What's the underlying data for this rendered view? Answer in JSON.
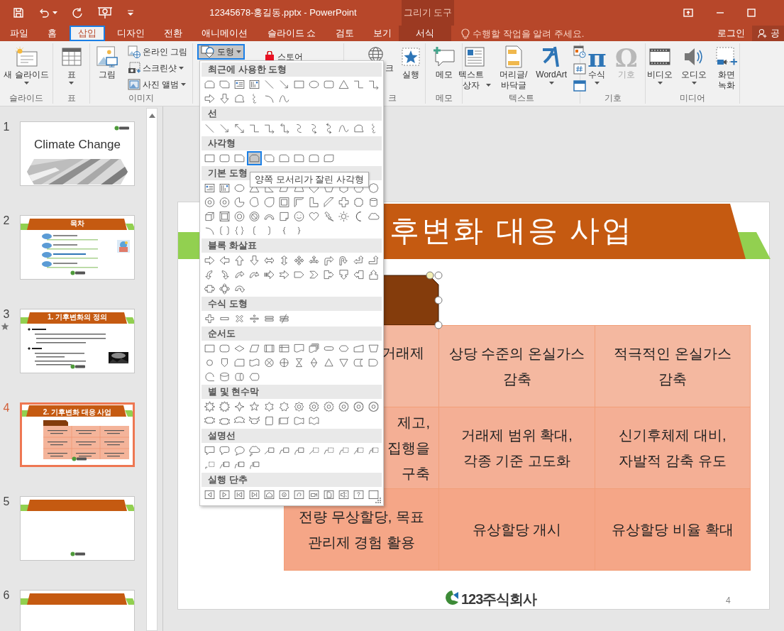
{
  "window": {
    "title": "12345678-홍길동.pptx - PowerPoint",
    "context_group": "그리기 도구"
  },
  "tabs": [
    {
      "label": "파일",
      "kind": "normal",
      "selected": false
    },
    {
      "label": "홈",
      "kind": "normal",
      "selected": false
    },
    {
      "label": "삽입",
      "kind": "normal",
      "selected": true
    },
    {
      "label": "디자인",
      "kind": "normal",
      "selected": false
    },
    {
      "label": "전환",
      "kind": "normal",
      "selected": false
    },
    {
      "label": "애니메이션",
      "kind": "normal",
      "selected": false
    },
    {
      "label": "슬라이드 쇼",
      "kind": "normal",
      "selected": false
    },
    {
      "label": "검토",
      "kind": "normal",
      "selected": false
    },
    {
      "label": "보기",
      "kind": "normal",
      "selected": false
    },
    {
      "label": "서식",
      "kind": "contextual",
      "selected": false
    }
  ],
  "tell_me": {
    "placeholder": "수행할 작업을 알려 주세요."
  },
  "account": {
    "sign_in": "로그인",
    "share": "공"
  },
  "ribbon": {
    "groups": [
      {
        "label": "슬라이드",
        "buttons": [
          {
            "label": "새 슬라이드",
            "kind": "large",
            "dropdown": true,
            "pressed": false,
            "disabled": false
          }
        ]
      },
      {
        "label": "표",
        "buttons": [
          {
            "label": "표",
            "kind": "large",
            "dropdown": true,
            "pressed": false,
            "disabled": false
          }
        ]
      },
      {
        "label": "이미지",
        "buttons": [
          {
            "label": "그림",
            "kind": "large",
            "dropdown": false,
            "pressed": false,
            "disabled": false
          },
          {
            "label": "온라인 그림",
            "kind": "small",
            "dropdown": false,
            "pressed": false,
            "disabled": false
          },
          {
            "label": "스크린샷",
            "kind": "small",
            "dropdown": true,
            "pressed": false,
            "disabled": false
          },
          {
            "label": "사진 앨범",
            "kind": "small",
            "dropdown": true,
            "pressed": false,
            "disabled": false
          }
        ]
      },
      {
        "buttons": [
          {
            "label": "도형",
            "kind": "small",
            "dropdown": true,
            "pressed": true,
            "disabled": false
          }
        ]
      },
      {
        "buttons": [
          {
            "label": "스토어",
            "kind": "small",
            "dropdown": false,
            "pressed": false,
            "disabled": false
          }
        ]
      },
      {
        "label": "크",
        "buttons": [
          {
            "label": "크",
            "kind": "large",
            "dropdown": false,
            "pressed": false,
            "disabled": false
          },
          {
            "label": "실행",
            "kind": "large",
            "dropdown": false,
            "pressed": false,
            "disabled": false
          }
        ]
      },
      {
        "label": "메모",
        "buttons": [
          {
            "label": "메모",
            "kind": "large",
            "dropdown": false,
            "pressed": false,
            "disabled": false
          }
        ]
      },
      {
        "label": "텍스트",
        "buttons": [
          {
            "label": "텍스트\n상자",
            "kind": "large",
            "dropdown": true,
            "pressed": false,
            "disabled": false
          },
          {
            "label": "머리글/\n바닥글",
            "kind": "large",
            "dropdown": false,
            "pressed": false,
            "disabled": false
          },
          {
            "label": "WordArt",
            "kind": "large",
            "dropdown": true,
            "pressed": false,
            "disabled": false
          },
          {
            "kind": "mini",
            "pressed": false,
            "disabled": false
          },
          {
            "kind": "mini",
            "pressed": false,
            "disabled": false
          },
          {
            "kind": "mini",
            "pressed": false,
            "disabled": false
          }
        ]
      },
      {
        "label": "기호",
        "buttons": [
          {
            "label": "수식",
            "symbol": "π",
            "kind": "large",
            "dropdown": true,
            "pressed": false,
            "disabled": false
          },
          {
            "label": "기호",
            "symbol": "Ω",
            "kind": "large",
            "dropdown": false,
            "pressed": false,
            "disabled": true
          }
        ]
      },
      {
        "label": "미디어",
        "buttons": [
          {
            "label": "비디오",
            "kind": "large",
            "dropdown": true,
            "pressed": false,
            "disabled": false
          },
          {
            "label": "오디오",
            "kind": "large",
            "dropdown": true,
            "pressed": false,
            "disabled": false
          },
          {
            "label": "화면\n녹화",
            "kind": "large",
            "dropdown": false,
            "pressed": false,
            "disabled": false
          }
        ]
      }
    ]
  },
  "thumbnails": [
    {
      "number": "1",
      "kind": "title",
      "title": "Climate Change",
      "selected": false,
      "animated": false
    },
    {
      "number": "2",
      "kind": "toc",
      "title": "목차",
      "selected": false,
      "animated": false
    },
    {
      "number": "3",
      "kind": "bullets",
      "title": "1. 기후변화의 정의",
      "selected": false,
      "animated": true
    },
    {
      "number": "4",
      "kind": "table",
      "title": "2. 기후변화 대응 사업",
      "selected": true,
      "animated": false
    },
    {
      "number": "5",
      "kind": "blank",
      "selected": false,
      "animated": false
    },
    {
      "number": "6",
      "kind": "banner",
      "selected": false,
      "animated": false
    }
  ],
  "slide": {
    "title": "후변화 대응 사업",
    "table": {
      "rows": [
        [
          "거래제",
          "상당 수준의 온실가스\n감축",
          "적극적인 온실가스\n감축"
        ],
        [
          "제고,\n집행을\n구축",
          "거래제 범위 확대,\n각종 기준 고도화",
          "신기후체제 대비,\n자발적 감축 유도"
        ],
        [
          "전량 무상할당, 목표\n관리제 경험 활용",
          "유상할당 개시",
          "유상할당 비율 확대"
        ]
      ]
    },
    "logo": "123주식회사",
    "page_number": "4"
  },
  "shapes_menu": {
    "tooltip": "양쪽 모서리가 잘린 사각형",
    "sections": [
      {
        "title": "최근에 사용한 도형",
        "shapes": [
          {
            "kind": "snip-same",
            "selected": false
          },
          {
            "kind": "snip-diagonal",
            "selected": false
          },
          {
            "kind": "text-box",
            "selected": false
          },
          {
            "kind": "vertical-text-box",
            "selected": false
          },
          {
            "kind": "line",
            "selected": false
          },
          {
            "kind": "arrow",
            "selected": false
          },
          {
            "kind": "rectangle",
            "selected": false
          },
          {
            "kind": "oval",
            "selected": false
          },
          {
            "kind": "rounded-rectangle",
            "selected": false
          },
          {
            "kind": "triangle",
            "selected": false
          },
          {
            "kind": "elbow-connector",
            "selected": false
          },
          {
            "kind": "elbow-arrow",
            "selected": false
          },
          {
            "kind": "right-arrow",
            "selected": false
          },
          {
            "kind": "down-arrow",
            "selected": false
          },
          {
            "kind": "freeform",
            "selected": false
          },
          {
            "kind": "scribble",
            "selected": false
          },
          {
            "kind": "arc",
            "selected": false
          },
          {
            "kind": "curve",
            "selected": false
          }
        ]
      },
      {
        "title": "선",
        "shapes": [
          {
            "kind": "line",
            "selected": false
          },
          {
            "kind": "arrow",
            "selected": false
          },
          {
            "kind": "double-arrow",
            "selected": false
          },
          {
            "kind": "elbow-connector",
            "selected": false
          },
          {
            "kind": "elbow-arrow",
            "selected": false
          },
          {
            "kind": "elbow-double-arrow",
            "selected": false
          },
          {
            "kind": "curved-connector",
            "selected": false
          },
          {
            "kind": "curved-arrow",
            "selected": false
          },
          {
            "kind": "curved-double-arrow",
            "selected": false
          },
          {
            "kind": "curve",
            "selected": false
          },
          {
            "kind": "freeform",
            "selected": false
          },
          {
            "kind": "scribble",
            "selected": false
          }
        ]
      },
      {
        "title": "사각형",
        "shapes": [
          {
            "kind": "rectangle",
            "selected": false
          },
          {
            "kind": "rounded-rectangle",
            "selected": false
          },
          {
            "kind": "snip-corner",
            "selected": false
          },
          {
            "kind": "snip-same",
            "selected": true
          },
          {
            "kind": "snip-diagonal",
            "selected": false
          },
          {
            "kind": "snip-round",
            "selected": false
          },
          {
            "kind": "round-corner",
            "selected": false
          },
          {
            "kind": "round-same",
            "selected": false
          },
          {
            "kind": "round-diagonal",
            "selected": false
          }
        ]
      },
      {
        "title": "기본 도형",
        "shapes": [
          {
            "kind": "text-box",
            "selected": false
          },
          {
            "kind": "vertical-text-box",
            "selected": false
          },
          {
            "kind": "oval",
            "selected": false
          },
          {
            "kind": "triangle",
            "selected": false
          },
          {
            "kind": "right-triangle",
            "selected": false
          },
          {
            "kind": "parallelogram",
            "selected": false
          },
          {
            "kind": "trapezoid",
            "selected": false
          },
          {
            "kind": "diamond",
            "selected": false
          },
          {
            "kind": "pentagon",
            "selected": false
          },
          {
            "kind": "hexagon",
            "selected": false
          },
          {
            "kind": "heptagon",
            "selected": false
          },
          {
            "kind": "octagon",
            "selected": false
          },
          {
            "kind": "decagon",
            "selected": false
          },
          {
            "kind": "dodecagon",
            "selected": false
          },
          {
            "kind": "pie",
            "selected": false
          },
          {
            "kind": "chord",
            "selected": false
          },
          {
            "kind": "teardrop",
            "selected": false
          },
          {
            "kind": "frame",
            "selected": false
          },
          {
            "kind": "half-frame",
            "selected": false
          },
          {
            "kind": "l-shape",
            "selected": false
          },
          {
            "kind": "diagonal-stripe",
            "selected": false
          },
          {
            "kind": "cross",
            "selected": false
          },
          {
            "kind": "plaque",
            "selected": false
          },
          {
            "kind": "can",
            "selected": false
          },
          {
            "kind": "cube",
            "selected": false
          },
          {
            "kind": "bevel",
            "selected": false
          },
          {
            "kind": "donut",
            "selected": false
          },
          {
            "kind": "no-symbol",
            "selected": false
          },
          {
            "kind": "block-arc",
            "selected": false
          },
          {
            "kind": "folded-corner",
            "selected": false
          },
          {
            "kind": "smiley",
            "selected": false
          },
          {
            "kind": "heart",
            "selected": false
          },
          {
            "kind": "lightning",
            "selected": false
          },
          {
            "kind": "sun",
            "selected": false
          },
          {
            "kind": "moon",
            "selected": false
          },
          {
            "kind": "cloud",
            "selected": false
          },
          {
            "kind": "arc",
            "selected": false
          },
          {
            "kind": "bracket-pair",
            "selected": false
          },
          {
            "kind": "brace-pair",
            "selected": false
          },
          {
            "kind": "left-bracket",
            "selected": false
          },
          {
            "kind": "right-bracket",
            "selected": false
          },
          {
            "kind": "left-brace",
            "selected": false
          },
          {
            "kind": "right-brace",
            "selected": false
          }
        ]
      },
      {
        "title": "블록 화살표",
        "shapes": [
          {
            "kind": "right-arrow",
            "selected": false
          },
          {
            "kind": "left-arrow",
            "selected": false
          },
          {
            "kind": "up-arrow",
            "selected": false
          },
          {
            "kind": "down-arrow",
            "selected": false
          },
          {
            "kind": "left-right-arrow",
            "selected": false
          },
          {
            "kind": "up-down-arrow",
            "selected": false
          },
          {
            "kind": "quad-arrow",
            "selected": false
          },
          {
            "kind": "left-right-up-arrow",
            "selected": false
          },
          {
            "kind": "bent-arrow",
            "selected": false
          },
          {
            "kind": "u-turn-arrow",
            "selected": false
          },
          {
            "kind": "left-up-arrow",
            "selected": false
          },
          {
            "kind": "bent-up-arrow",
            "selected": false
          },
          {
            "kind": "curved-right-arrow",
            "selected": false
          },
          {
            "kind": "curved-left-arrow",
            "selected": false
          },
          {
            "kind": "curved-up-arrow",
            "selected": false
          },
          {
            "kind": "curved-down-arrow",
            "selected": false
          },
          {
            "kind": "striped-arrow",
            "selected": false
          },
          {
            "kind": "notched-arrow",
            "selected": false
          },
          {
            "kind": "home-plate",
            "selected": false
          },
          {
            "kind": "chevron",
            "selected": false
          },
          {
            "kind": "right-arrow-callout",
            "selected": false
          },
          {
            "kind": "down-arrow-callout",
            "selected": false
          },
          {
            "kind": "left-arrow-callout",
            "selected": false
          },
          {
            "kind": "up-arrow-callout",
            "selected": false
          },
          {
            "kind": "left-right-callout",
            "selected": false
          },
          {
            "kind": "quad-callout",
            "selected": false
          },
          {
            "kind": "circular-arrow",
            "selected": false
          }
        ]
      },
      {
        "title": "수식 도형",
        "shapes": [
          {
            "kind": "plus",
            "selected": false
          },
          {
            "kind": "minus",
            "selected": false
          },
          {
            "kind": "multiply",
            "selected": false
          },
          {
            "kind": "divide",
            "selected": false
          },
          {
            "kind": "equal",
            "selected": false
          },
          {
            "kind": "not-equal",
            "selected": false
          }
        ]
      },
      {
        "title": "순서도",
        "shapes": [
          {
            "kind": "process",
            "selected": false
          },
          {
            "kind": "alternate-process",
            "selected": false
          },
          {
            "kind": "decision",
            "selected": false
          },
          {
            "kind": "data",
            "selected": false
          },
          {
            "kind": "predefined-process",
            "selected": false
          },
          {
            "kind": "internal-storage",
            "selected": false
          },
          {
            "kind": "document",
            "selected": false
          },
          {
            "kind": "multidocument",
            "selected": false
          },
          {
            "kind": "terminator",
            "selected": false
          },
          {
            "kind": "preparation",
            "selected": false
          },
          {
            "kind": "manual-input",
            "selected": false
          },
          {
            "kind": "manual-operation",
            "selected": false
          },
          {
            "kind": "connector",
            "selected": false
          },
          {
            "kind": "off-page-connector",
            "selected": false
          },
          {
            "kind": "card",
            "selected": false
          },
          {
            "kind": "punched-tape",
            "selected": false
          },
          {
            "kind": "summing-junction",
            "selected": false
          },
          {
            "kind": "or-symbol",
            "selected": false
          },
          {
            "kind": "collate",
            "selected": false
          },
          {
            "kind": "sort",
            "selected": false
          },
          {
            "kind": "extract",
            "selected": false
          },
          {
            "kind": "merge",
            "selected": false
          },
          {
            "kind": "stored-data",
            "selected": false
          },
          {
            "kind": "delay",
            "selected": false
          },
          {
            "kind": "sequential-storage",
            "selected": false
          },
          {
            "kind": "magnetic-disk",
            "selected": false
          },
          {
            "kind": "direct-storage",
            "selected": false
          },
          {
            "kind": "display",
            "selected": false
          }
        ]
      },
      {
        "title": "별 및 현수막",
        "shapes": [
          {
            "kind": "explosion",
            "selected": false
          },
          {
            "kind": "explosion-large",
            "selected": false
          },
          {
            "kind": "star4",
            "selected": false
          },
          {
            "kind": "star5",
            "selected": false
          },
          {
            "kind": "star6",
            "selected": false
          },
          {
            "kind": "star7",
            "selected": false
          },
          {
            "kind": "star8",
            "selected": false
          },
          {
            "kind": "star10",
            "selected": false
          },
          {
            "kind": "star12",
            "selected": false
          },
          {
            "kind": "star16",
            "selected": false
          },
          {
            "kind": "star24",
            "selected": false
          },
          {
            "kind": "star32",
            "selected": false
          },
          {
            "kind": "ribbon-down",
            "selected": false
          },
          {
            "kind": "ribbon-up",
            "selected": false
          },
          {
            "kind": "curved-ribbon-down",
            "selected": false
          },
          {
            "kind": "curved-ribbon-up",
            "selected": false
          },
          {
            "kind": "vertical-scroll",
            "selected": false
          },
          {
            "kind": "horizontal-scroll",
            "selected": false
          },
          {
            "kind": "wave",
            "selected": false
          },
          {
            "kind": "double-wave",
            "selected": false
          }
        ]
      },
      {
        "title": "설명선",
        "shapes": [
          {
            "kind": "rect-callout",
            "selected": false
          },
          {
            "kind": "rounded-callout",
            "selected": false
          },
          {
            "kind": "oval-callout",
            "selected": false
          },
          {
            "kind": "cloud-callout",
            "selected": false
          },
          {
            "kind": "line-callout",
            "selected": false
          },
          {
            "kind": "line-callout-bent",
            "selected": false
          },
          {
            "kind": "line-callout-double",
            "selected": false
          },
          {
            "kind": "dashed-callout",
            "selected": false
          },
          {
            "kind": "dashed-callout-bent",
            "selected": false
          },
          {
            "kind": "dashed-callout-double",
            "selected": false
          },
          {
            "kind": "dashed-line-callout",
            "selected": false
          },
          {
            "kind": "dashed-line-callout-bent",
            "selected": false
          },
          {
            "kind": "dashed-callout-hook",
            "selected": false
          },
          {
            "kind": "bar-callout",
            "selected": false
          },
          {
            "kind": "bar-callout-bent",
            "selected": false
          },
          {
            "kind": "bar-callout-double",
            "selected": false
          }
        ]
      },
      {
        "title": "실행 단추",
        "shapes": [
          {
            "kind": "back-action",
            "selected": false
          },
          {
            "kind": "forward-action",
            "selected": false
          },
          {
            "kind": "beginning-action",
            "selected": false
          },
          {
            "kind": "end-action",
            "selected": false
          },
          {
            "kind": "home-action",
            "selected": false
          },
          {
            "kind": "info-action",
            "selected": false
          },
          {
            "kind": "return-action",
            "selected": false
          },
          {
            "kind": "movie-action",
            "selected": false
          },
          {
            "kind": "document-action",
            "selected": false
          },
          {
            "kind": "sound-action",
            "selected": false
          },
          {
            "kind": "help-action",
            "selected": false
          },
          {
            "kind": "blank-action",
            "selected": false
          }
        ]
      }
    ]
  }
}
